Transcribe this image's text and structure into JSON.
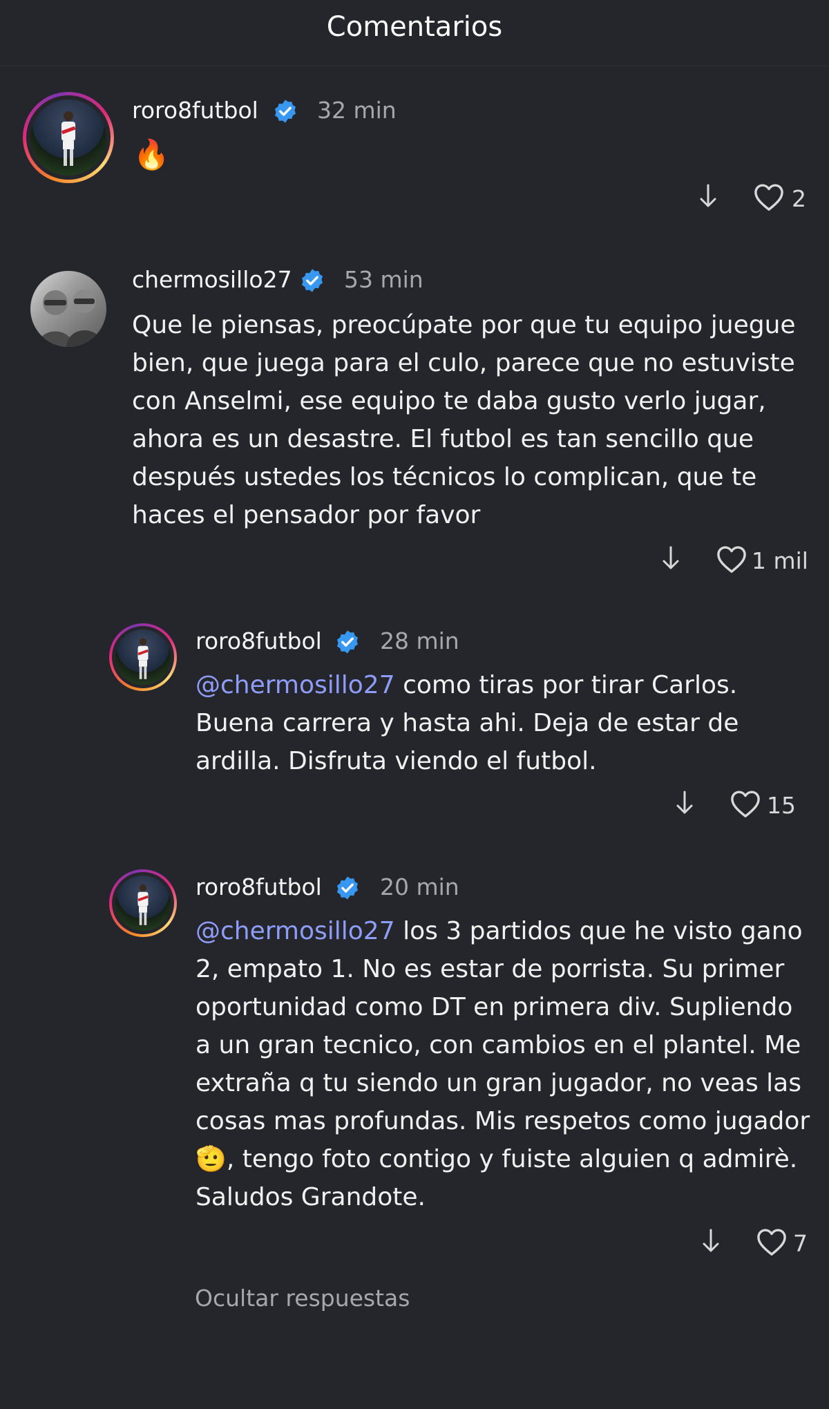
{
  "header": {
    "title": "Comentarios"
  },
  "comments": [
    {
      "username": "roro8futbol",
      "time": "32 min",
      "text": "🔥",
      "likes": "2"
    },
    {
      "username": "chermosillo27",
      "time": "53 min",
      "text": "Que le piensas, preocúpate por que tu equipo juegue bien, que juega para el culo, parece que no estuviste con Anselmi, ese equipo te daba gusto verlo jugar, ahora es un desastre. El futbol es tan sencillo que después ustedes los técnicos lo complican, que te haces el pensador por favor",
      "likes": "1 mil"
    },
    {
      "username": "roro8futbol",
      "time": "28 min",
      "mention": "@chermosillo27",
      "text": " como tiras por tirar Carlos. Buena carrera y hasta ahi. Deja de estar de ardilla. Disfruta viendo el futbol.",
      "likes": "15"
    },
    {
      "username": "roro8futbol",
      "time": "20 min",
      "mention": "@chermosillo27",
      "text": " los 3 partidos que he visto gano 2, empato 1. No es estar de porrista. Su primer oportunidad como DT en primera div. Supliendo a un gran tecnico, con cambios en el plantel. Me extraña q tu siendo un gran jugador, no veas las cosas mas profundas. Mis respetos como jugador 🫡, tengo foto contigo y fuiste alguien q admirè. Saludos Grandote.",
      "likes": "7"
    }
  ],
  "footer": {
    "hide_replies": "Ocultar respuestas"
  },
  "colors": {
    "background": "#25262b",
    "mention": "#8f9dfa",
    "verified": "#3897f0",
    "secondary_text": "#a6a8ad"
  },
  "icons": {
    "verified": "verified-badge-icon",
    "reply": "arrow-down-icon",
    "like": "heart-outline-icon"
  }
}
